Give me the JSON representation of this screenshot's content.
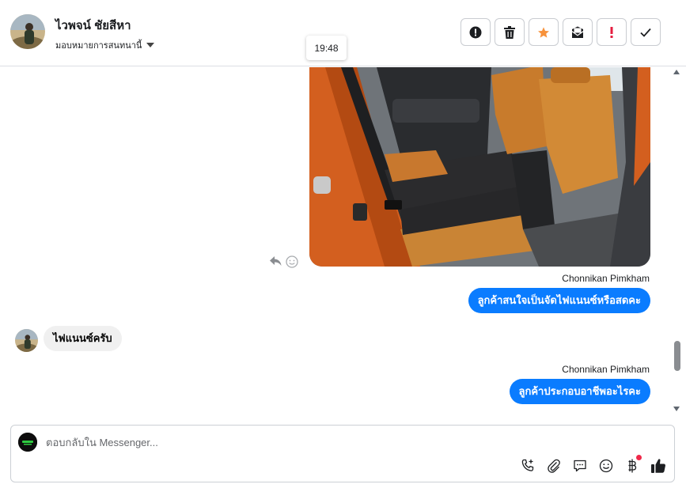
{
  "header": {
    "contact_name": "ไวพจน์ ชัยสีหา",
    "assign_label": "มอบหมายการสนทนานี้",
    "actions": [
      {
        "name": "report-spam-button",
        "icon": "alert-circle-icon"
      },
      {
        "name": "delete-button",
        "icon": "trash-icon"
      },
      {
        "name": "star-button",
        "icon": "star-icon",
        "color": "#f7923b"
      },
      {
        "name": "mark-unread-button",
        "icon": "envelope-icon"
      },
      {
        "name": "important-button",
        "icon": "exclamation-icon",
        "color": "#e41e3f"
      },
      {
        "name": "done-button",
        "icon": "check-icon"
      }
    ]
  },
  "tooltip": {
    "time": "19:48"
  },
  "messages": [
    {
      "type": "image",
      "direction": "outgoing",
      "icon_reply": "reply-icon",
      "icon_react": "smile-icon"
    },
    {
      "type": "text",
      "direction": "outgoing",
      "sender": "Chonnikan Pimkham",
      "text": "ลูกค้าสนใจเป็นจัดไฟแนนซ์หรือสดคะ"
    },
    {
      "type": "text",
      "direction": "incoming",
      "text": "ไฟแนนซ์ครับ"
    },
    {
      "type": "text",
      "direction": "outgoing",
      "sender": "Chonnikan Pimkham",
      "text": "ลูกค้าประกอบอาชีพอะไรคะ"
    }
  ],
  "composer": {
    "placeholder": "ตอบกลับใน Messenger...",
    "icons": [
      "call-add-icon",
      "paperclip-icon",
      "saved-reply-icon",
      "emoji-icon",
      "baht-payment-icon",
      "thumbs-up-icon"
    ],
    "accent": "#0a7cff"
  }
}
